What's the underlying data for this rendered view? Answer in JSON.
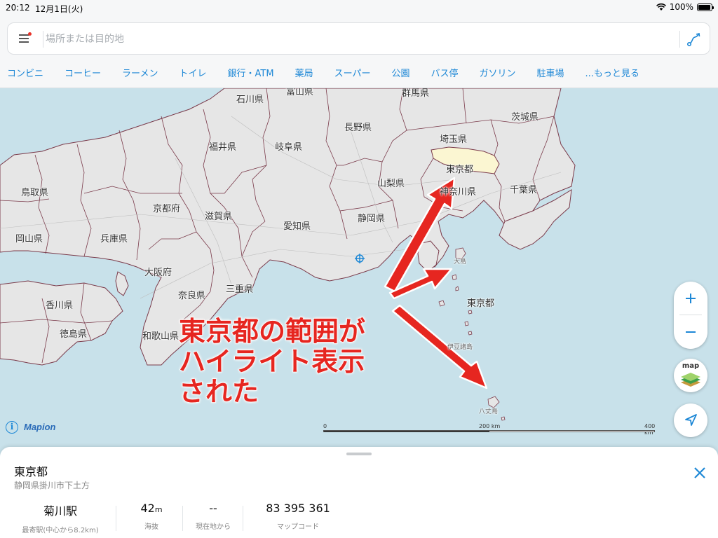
{
  "status_bar": {
    "time": "20:12",
    "date": "12月1日(火)",
    "battery": "100%",
    "battery_level": 1.0
  },
  "search": {
    "placeholder": "場所または目的地",
    "value": ""
  },
  "categories": [
    "コンビニ",
    "コーヒー",
    "ラーメン",
    "トイレ",
    "銀行・ATM",
    "薬局",
    "スーパー",
    "公園",
    "バス停",
    "ガソリン",
    "駐車場",
    "...もっと見る"
  ],
  "map": {
    "labels": {
      "toyama": "富山県",
      "ishikawa": "石川県",
      "gunma": "群馬県",
      "ibaraki": "茨城県",
      "nagano": "長野県",
      "saitama": "埼玉県",
      "fukui": "福井県",
      "gifu": "岐阜県",
      "tokyo": "東京都",
      "kanagawa": "神奈川県",
      "chiba": "千葉県",
      "tottori": "鳥取県",
      "yamanashi": "山梨県",
      "kyoto": "京都府",
      "shiga": "滋賀県",
      "shizuoka": "静岡県",
      "okayama": "岡山県",
      "hyogo": "兵庫県",
      "aichi": "愛知県",
      "osaka": "大阪府",
      "nara": "奈良県",
      "mie": "三重県",
      "kagawa": "香川県",
      "wakayama": "和歌山県",
      "tokushima": "徳島県",
      "tokyo_islands": "東京都",
      "oshima": "大島",
      "izu_islands": "伊豆諸島",
      "hachijo": "八丈島"
    },
    "highlight_color": "#fbf6d2",
    "scale": {
      "start": "0",
      "mid": "200 km",
      "end": "400 km",
      "filled_fraction": 0.5
    },
    "brand": "Mapion",
    "layer_button_label": "map"
  },
  "annotation": {
    "lines": [
      "東京都の範囲が",
      "ハイライト表示",
      "された"
    ],
    "color": "#e62620"
  },
  "place": {
    "title": "東京都",
    "address": "静岡県掛川市下土方",
    "stats": [
      {
        "value": "菊川駅",
        "unit": "",
        "label": "最寄駅(中心から8.2km)"
      },
      {
        "value": "42",
        "unit": "m",
        "label": "海抜"
      },
      {
        "value": "--",
        "unit": "",
        "label": "現在地から"
      },
      {
        "value": "83 395 361",
        "unit": "",
        "label": "マップコード"
      }
    ]
  },
  "colors": {
    "accent": "#1e88d6",
    "land": "#e6e6e6",
    "sea": "#c8e1ea",
    "border": "#7a3a4a"
  }
}
